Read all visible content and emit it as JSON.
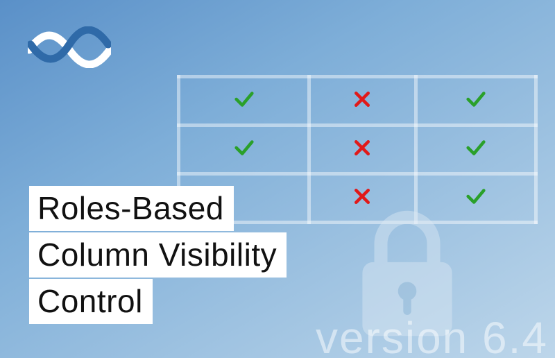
{
  "title": {
    "line1": "Roles-Based",
    "line2": "Column Visibility",
    "line3": "Control"
  },
  "version_label": "version 6.4",
  "table": {
    "rows": [
      {
        "cells": [
          "check",
          "cross",
          "check"
        ]
      },
      {
        "cells": [
          "check",
          "cross",
          "check"
        ]
      },
      {
        "cells": [
          "",
          "cross",
          "check"
        ]
      }
    ]
  },
  "icons": {
    "check_color": "#2aa02a",
    "cross_color": "#e11919"
  }
}
